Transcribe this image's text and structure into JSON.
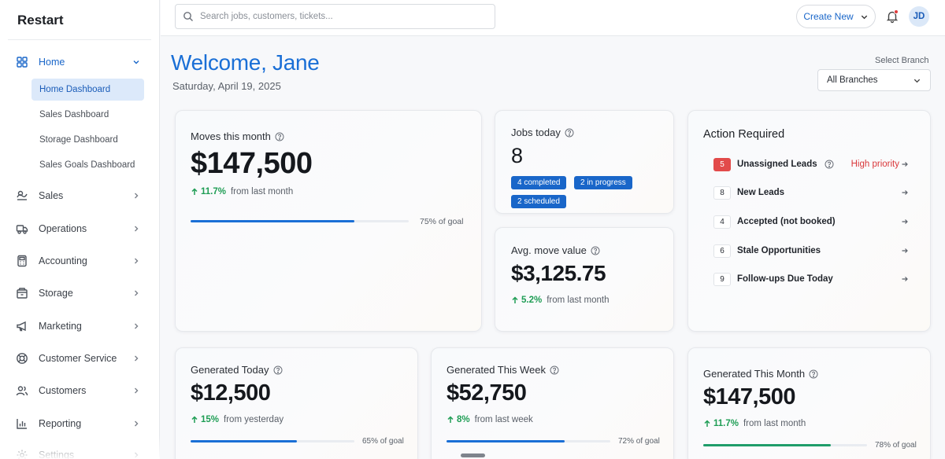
{
  "brand": "Restart",
  "sidebar": {
    "items": [
      {
        "label": "Home",
        "icon": "grid-icon"
      },
      {
        "label": "Sales",
        "icon": "sales-icon"
      },
      {
        "label": "Operations",
        "icon": "truck-icon"
      },
      {
        "label": "Accounting",
        "icon": "calculator-icon"
      },
      {
        "label": "Storage",
        "icon": "storage-icon"
      },
      {
        "label": "Marketing",
        "icon": "megaphone-icon"
      },
      {
        "label": "Customer Service",
        "icon": "lifebuoy-icon"
      },
      {
        "label": "Customers",
        "icon": "users-icon"
      },
      {
        "label": "Reporting",
        "icon": "bar-chart-icon"
      },
      {
        "label": "Settings",
        "icon": "gear-icon"
      }
    ],
    "home_sub": [
      {
        "label": "Home Dashboard"
      },
      {
        "label": "Sales Dashboard"
      },
      {
        "label": "Storage Dashboard"
      },
      {
        "label": "Sales Goals Dashboard"
      }
    ]
  },
  "topbar": {
    "search_placeholder": "Search jobs, customers, tickets...",
    "create_label": "Create New",
    "avatar_initials": "JD"
  },
  "header": {
    "welcome": "Welcome, Jane",
    "date": "Saturday, April 19, 2025",
    "branch_label": "Select Branch",
    "branch_value": "All Branches"
  },
  "moves": {
    "title": "Moves this month",
    "value": "$147,500",
    "delta": "11.7%",
    "delta_text": "from last month",
    "progress": 0.75,
    "goal_text": "75% of goal"
  },
  "jobs": {
    "title": "Jobs today",
    "value": "8",
    "badges": [
      "4 completed",
      "2 in progress",
      "2 scheduled"
    ]
  },
  "avg": {
    "title": "Avg. move value",
    "value": "$3,125.75",
    "delta": "5.2%",
    "delta_text": "from last month"
  },
  "action": {
    "title": "Action Required",
    "priority_text": "High priority",
    "rows": [
      {
        "count": "5",
        "label": "Unassigned Leads"
      },
      {
        "count": "8",
        "label": "New Leads"
      },
      {
        "count": "4",
        "label": "Accepted (not booked)"
      },
      {
        "count": "6",
        "label": "Stale Opportunities"
      },
      {
        "count": "9",
        "label": "Follow-ups Due Today"
      }
    ]
  },
  "gen_today": {
    "title": "Generated Today",
    "value": "$12,500",
    "delta": "15%",
    "delta_text": "from yesterday",
    "progress": 0.65,
    "goal_text": "65% of goal"
  },
  "gen_week": {
    "title": "Generated This Week",
    "value": "$52,750",
    "delta": "8%",
    "delta_text": "from last week",
    "progress": 0.72,
    "goal_text": "72% of goal"
  },
  "gen_month": {
    "title": "Generated This Month",
    "value": "$147,500",
    "delta": "11.7%",
    "delta_text": "from last month",
    "progress": 0.78,
    "goal_text": "78% of goal"
  },
  "colors": {
    "accent": "#1a6fd6",
    "positive": "#1f9d55",
    "danger": "#d9373a",
    "progress_green": "#1f9d6a"
  }
}
